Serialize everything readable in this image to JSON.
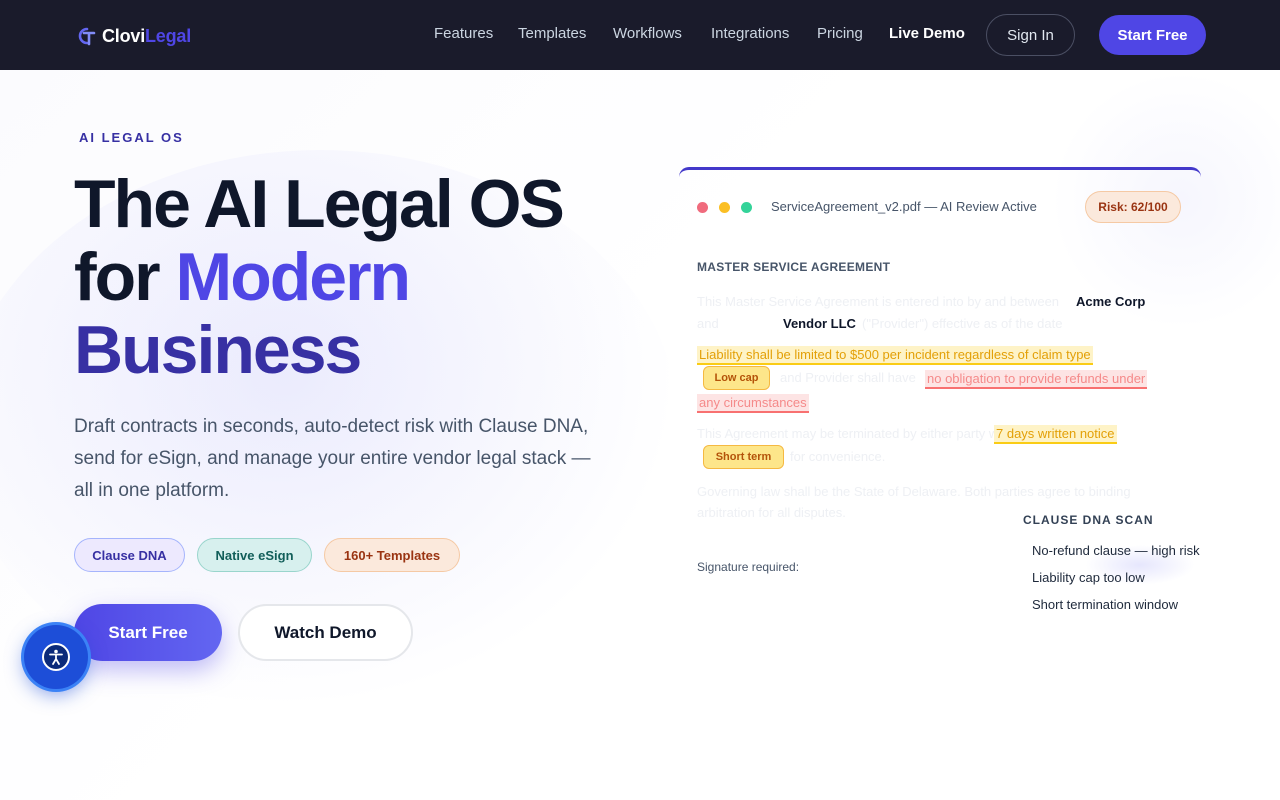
{
  "brand": {
    "name_a": "Clovi",
    "name_b": "Legal",
    "accent": "#4f46e5",
    "nav_bg": "#1a1b2b"
  },
  "nav": {
    "links": [
      "Features",
      "Templates",
      "Workflows",
      "Integrations",
      "Pricing",
      "Live Demo"
    ],
    "sign_in": "Sign In",
    "start_free": "Start Free"
  },
  "hero": {
    "eyebrow": "AI LEGAL OS",
    "headline": {
      "line1": "The AI Legal OS",
      "line2_a": "for ",
      "line2_b": "Modern",
      "line3": "Business"
    },
    "subtext": "Draft contracts in seconds, auto-detect risk with Clause DNA, send for eSign, and manage your entire vendor legal stack — all in one platform.",
    "pills": [
      "Clause DNA",
      "Native eSign",
      "160+ Templates"
    ],
    "cta_primary": "Start Free",
    "cta_secondary": "Watch Demo"
  },
  "document": {
    "file_title": "ServiceAgreement_v2.pdf — AI Review Active",
    "risk": "Risk: 62/100",
    "heading": "MASTER SERVICE AGREEMENT",
    "party_a": "Acme Corp",
    "party_b": "Vendor LLC",
    "faint_1": "This Master Service Agreement is entered into by and between",
    "faint_2": "and",
    "faint_3": "(\"Provider\") effective as of the date",
    "clause_liability": "Liability shall be limited to $500 per incident regardless of claim type",
    "faint_4": "and Provider shall have",
    "clause_refund_a": "no obligation to provide refunds under",
    "clause_refund_b": "any circumstances",
    "tag_low_cap": "Low cap",
    "faint_5": "This Agreement may be terminated by either party with",
    "clause_notice": "7 days written notice",
    "faint_6": "for convenience.",
    "tag_short_term": "Short term",
    "faint_7": "Governing law shall be the State of Delaware. Both parties agree to binding",
    "faint_8": "arbitration for all disputes.",
    "signature": "Signature required:"
  },
  "clause_dna": {
    "title": "CLAUSE DNA SCAN",
    "items": [
      "No-refund clause — high risk",
      "Liability cap too low",
      "Short termination window"
    ]
  },
  "icons": [
    "logo-icon",
    "accessibility-icon",
    "window-dot-red",
    "window-dot-yellow",
    "window-dot-green"
  ]
}
